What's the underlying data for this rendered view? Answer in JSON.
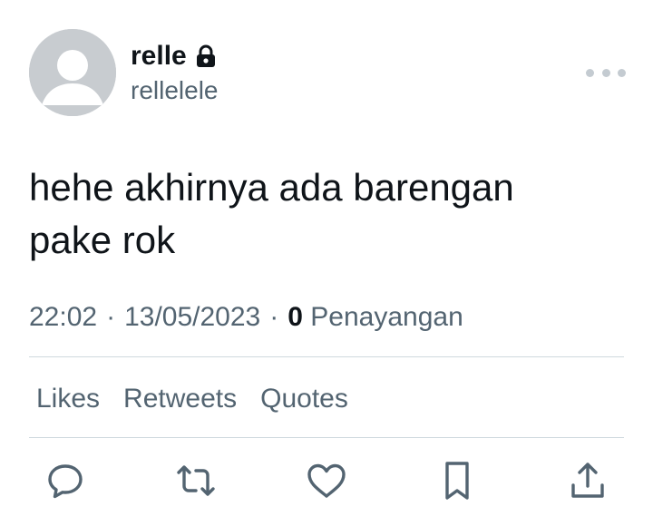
{
  "user": {
    "display_name": "relle",
    "handle": "rellelele",
    "protected_icon": "lock-icon",
    "avatar_icon": "default-avatar-icon"
  },
  "tweet": {
    "text_line1": "hehe akhirnya ada barengan",
    "text_line2": "pake rok"
  },
  "meta": {
    "time": "22:02",
    "separator": "·",
    "date": "13/05/2023",
    "views_count": "0",
    "views_label": "Penayangan"
  },
  "stats": {
    "likes": "Likes",
    "retweets": "Retweets",
    "quotes": "Quotes"
  },
  "actions": [
    "reply-icon",
    "retweet-icon",
    "like-icon",
    "bookmark-icon",
    "share-icon"
  ],
  "colors": {
    "text": "#0f1419",
    "secondary": "#536471",
    "divider": "#cfd9de",
    "avatar_bg": "#c8ccd0"
  }
}
